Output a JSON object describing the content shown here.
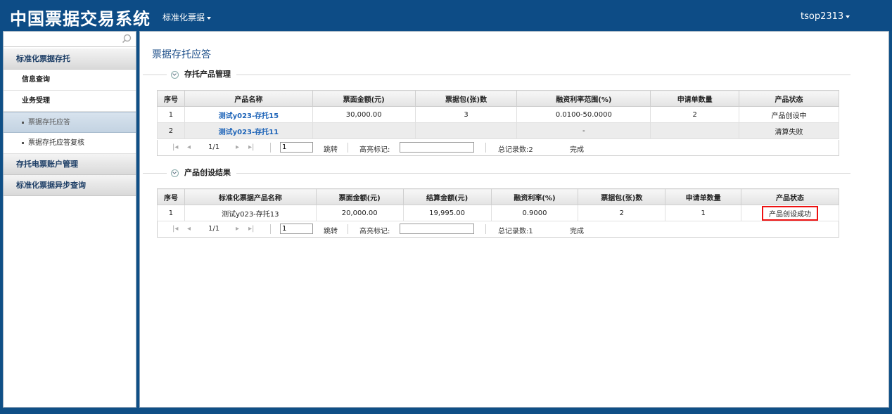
{
  "header": {
    "app_title": "中国票据交易系统",
    "menu_label": "标准化票据",
    "user_label": "tsop2313"
  },
  "sidebar": {
    "search_placeholder": "",
    "groups": [
      {
        "label": "标准化票据存托"
      },
      {
        "label": "存托电票账户管理"
      },
      {
        "label": "标准化票据异步查询"
      }
    ],
    "items": [
      {
        "label": "信息查询"
      },
      {
        "label": "业务受理"
      }
    ],
    "subitems": [
      {
        "label": "票据存托应答"
      },
      {
        "label": "票据存托应答复核"
      }
    ]
  },
  "main": {
    "page_title": "票据存托应答",
    "section1": {
      "title": "存托产品管理",
      "headers": [
        "序号",
        "产品名称",
        "票面金额(元)",
        "票据包(张)数",
        "融资利率范围(%)",
        "申请单数量",
        "产品状态"
      ],
      "rows": [
        [
          "1",
          "测试y023-存托15",
          "30,000.00",
          "3",
          "0.0100-50.0000",
          "2",
          "产品创设中"
        ],
        [
          "2",
          "测试y023-存托11",
          "",
          "",
          "-",
          "",
          "清算失败"
        ]
      ],
      "pager": {
        "page": "1/1",
        "page_input": "1",
        "jump": "跳转",
        "highlight_label": "高亮标记:",
        "total": "总记录数:2",
        "status": "完成"
      }
    },
    "section2": {
      "title": "产品创设结果",
      "headers": [
        "序号",
        "标准化票据产品名称",
        "票面金额(元)",
        "结算金额(元)",
        "融资利率(%)",
        "票据包(张)数",
        "申请单数量",
        "产品状态"
      ],
      "rows": [
        [
          "1",
          "测试y023-存托13",
          "20,000.00",
          "19,995.00",
          "0.9000",
          "2",
          "1",
          "产品创设成功"
        ]
      ],
      "pager": {
        "page": "1/1",
        "page_input": "1",
        "jump": "跳转",
        "highlight_label": "高亮标记:",
        "total": "总记录数:1",
        "status": "完成"
      }
    }
  },
  "colors": {
    "header_bg": "#0d4c86",
    "link": "#1e64b8",
    "highlight_border": "#e11111"
  },
  "icons": [
    "search-icon",
    "collapse-icon",
    "first-page-icon",
    "prev-page-icon",
    "next-page-icon",
    "last-page-icon",
    "caret-down-icon"
  ]
}
